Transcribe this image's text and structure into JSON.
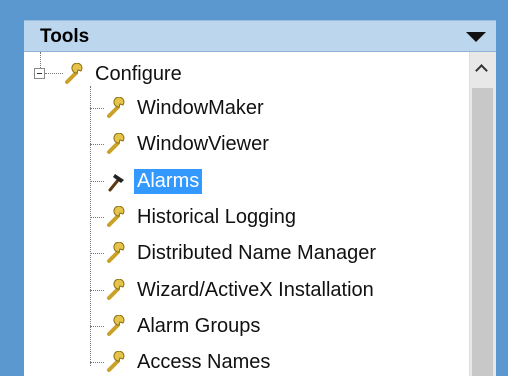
{
  "panel": {
    "title": "Tools",
    "root": {
      "label": "Configure",
      "icon": "wrench-icon"
    },
    "items": [
      {
        "label": "WindowMaker",
        "icon": "wrench-icon",
        "selected": false
      },
      {
        "label": "WindowViewer",
        "icon": "wrench-icon",
        "selected": false
      },
      {
        "label": "Alarms",
        "icon": "hammer-icon",
        "selected": true
      },
      {
        "label": "Historical Logging",
        "icon": "wrench-icon",
        "selected": false
      },
      {
        "label": "Distributed Name Manager",
        "icon": "wrench-icon",
        "selected": false
      },
      {
        "label": "Wizard/ActiveX Installation",
        "icon": "wrench-icon",
        "selected": false
      },
      {
        "label": "Alarm Groups",
        "icon": "wrench-icon",
        "selected": false
      },
      {
        "label": "Access Names",
        "icon": "wrench-icon",
        "selected": false
      }
    ]
  },
  "colors": {
    "header": "#bcd6ee",
    "frame": "#5b98cf",
    "selection": "#3399ff"
  }
}
